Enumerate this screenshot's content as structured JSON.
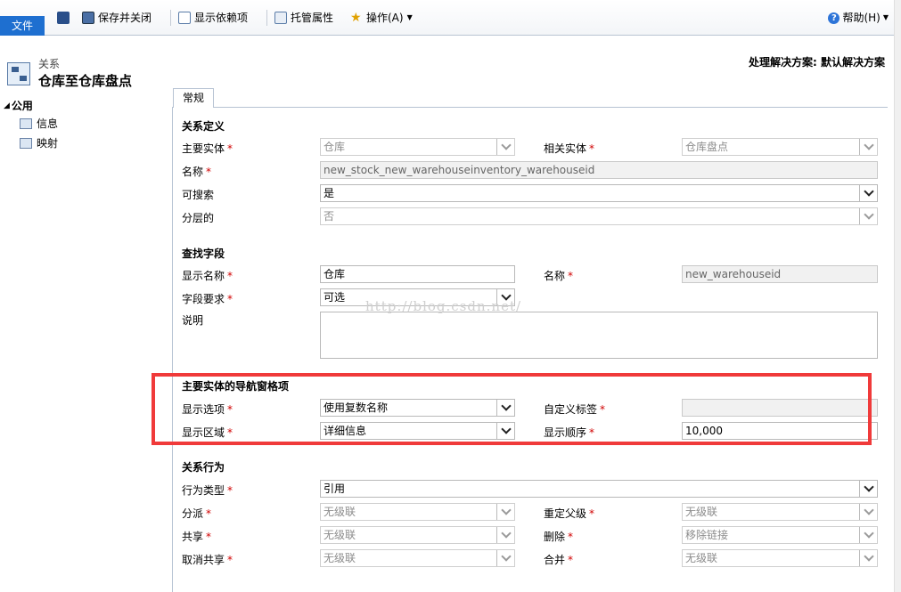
{
  "ribbon": {
    "file_tab": "文件",
    "save_close": "保存并关闭",
    "show_dependencies": "显示依赖项",
    "managed_properties": "托管属性",
    "actions": "操作(A)",
    "help": "帮助(H)"
  },
  "header": {
    "record_type": "关系",
    "title": "仓库至仓库盘点",
    "solution": "处理解决方案: 默认解决方案"
  },
  "nav": {
    "group": "公用",
    "items": [
      "信息",
      "映射"
    ]
  },
  "tab": {
    "label": "常规"
  },
  "watermark": "http://blog.csdn.net/",
  "sections": {
    "definition": {
      "title": "关系定义",
      "primary_entity_label": "主要实体",
      "primary_entity_value": "仓库",
      "related_entity_label": "相关实体",
      "related_entity_value": "仓库盘点",
      "name_label": "名称",
      "name_value": "new_stock_new_warehouseinventory_warehouseid",
      "searchable_label": "可搜索",
      "searchable_value": "是",
      "hierarchical_label": "分层的",
      "hierarchical_value": "否"
    },
    "lookup": {
      "title": "查找字段",
      "display_name_label": "显示名称",
      "display_name_value": "仓库",
      "name_label": "名称",
      "name_value": "new_warehouseid",
      "requirement_label": "字段要求",
      "requirement_value": "可选",
      "description_label": "说明"
    },
    "navigation": {
      "title": "主要实体的导航窗格项",
      "display_option_label": "显示选项",
      "display_option_value": "使用复数名称",
      "custom_label_label": "自定义标签",
      "custom_label_value": "",
      "display_area_label": "显示区域",
      "display_area_value": "详细信息",
      "display_order_label": "显示顺序",
      "display_order_value": "10,000"
    },
    "behavior": {
      "title": "关系行为",
      "type_label": "行为类型",
      "type_value": "引用",
      "assign_label": "分派",
      "assign_value": "无级联",
      "reparent_label": "重定父级",
      "reparent_value": "无级联",
      "share_label": "共享",
      "share_value": "无级联",
      "delete_label": "删除",
      "delete_value": "移除链接",
      "unshare_label": "取消共享",
      "unshare_value": "无级联",
      "merge_label": "合并",
      "merge_value": "无级联"
    }
  },
  "colors": {
    "file_tab": "#1e6fd0",
    "required": "#d00000",
    "highlight_box": "#f03a3a"
  }
}
